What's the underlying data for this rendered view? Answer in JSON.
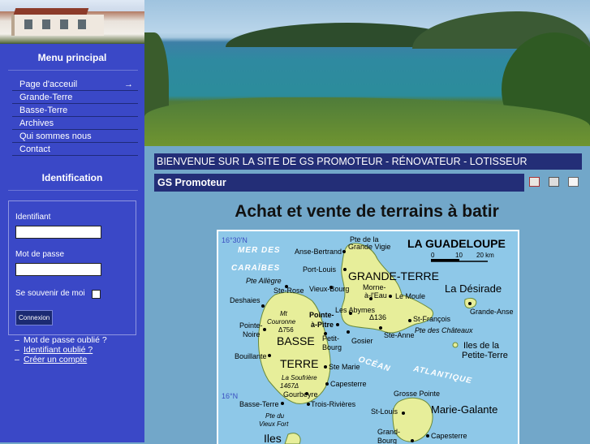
{
  "sidebar": {
    "menu_title": "Menu principal",
    "menu_items": [
      {
        "label": "Page d'acceuil",
        "arrow": "→"
      },
      {
        "label": "Grande-Terre"
      },
      {
        "label": "Basse-Terre"
      },
      {
        "label": "Archives"
      },
      {
        "label": "Qui sommes nous"
      },
      {
        "label": "Contact"
      }
    ],
    "ident_title": "Identification",
    "login": {
      "username_label": "Identifiant",
      "password_label": "Mot de passe",
      "remember_label": "Se souvenir de moi",
      "submit_label": "Connexion"
    },
    "links": {
      "forgot_password": "Mot de passe oublié ?",
      "forgot_username": "Identifiant oublié ?",
      "create_account": "Créer un compte",
      "dash": "–"
    }
  },
  "main": {
    "welcome_title": "BIENVENUE SUR LA SITE DE GS PROMOTEUR - RÉNOVATEUR - LOTISSEUR",
    "article_title": "GS Promoteur",
    "article_icons": [
      "pdf-icon",
      "print-icon",
      "email-icon"
    ],
    "headline": "Achat et vente de terrains à batir"
  },
  "map": {
    "title": "LA GUADELOUPE",
    "scale": [
      "0",
      "10",
      "20 km"
    ],
    "lat_labels": [
      "16°30'N",
      "16°N"
    ],
    "sea_labels": [
      "MER DES",
      "CARAÏBES",
      "OCÉAN",
      "ATLANTIQUE"
    ],
    "regions": [
      "GRANDE-TERRE",
      "BASSE",
      "TERRE",
      "La Désirade",
      "Marie-Galante",
      "Iles de la",
      "Petite-Terre",
      "Iles"
    ],
    "places": {
      "anse_bertrand": "Anse-Bertrand",
      "pte_grande_vigie": "Pte de la",
      "grande_vigie": "Grande Vigie",
      "port_louis": "Port-Louis",
      "pte_allegre": "Pte Allègre",
      "ste_rose": "Ste-Rose",
      "vieux_bourg": "Vieux-Bourg",
      "morne": "Morne-",
      "a_leau": "à-l'Eau",
      "le_moule": "Le Moule",
      "deshaies": "Deshaies",
      "mt_couronne_1": "Mt",
      "mt_couronne_2": "Couronne",
      "mt_couronne_alt": "Δ756",
      "pointe_a_pitre_1": "Pointe-",
      "pointe_a_pitre_2": "à-Pitre",
      "abymes": "Les Abymes",
      "alt136": "Δ136",
      "st_francois": "St-François",
      "anse_grande": "Grande-Anse",
      "pte_chateaux": "Pte des Châteaux",
      "pte_noire_1": "Pointe-",
      "pte_noire_2": "Noire",
      "petit_bourg_1": "Petit-",
      "petit_bourg_2": "Bourg",
      "gosier": "Gosier",
      "ste_anne": "Ste-Anne",
      "bouillante": "Bouillante",
      "ste_marie": "Ste Marie",
      "soufriere_1": "La Soufrière",
      "soufriere_2": "1467Δ",
      "capesterre": "Capesterre",
      "gourbeyre": "Gourbeyre",
      "basse_terre": "Basse-Terre",
      "trois_rivieres": "Trois-Rivières",
      "grosse_pointe": "Grosse Pointe",
      "st_louis": "St-Louis",
      "pte_vieux_fort_1": "Pte du",
      "pte_vieux_fort_2": "Vieux Fort",
      "grand_bourg_1": "Grand-",
      "grand_bourg_2": "Bourg",
      "capesterre_mg": "Capesterre"
    }
  }
}
